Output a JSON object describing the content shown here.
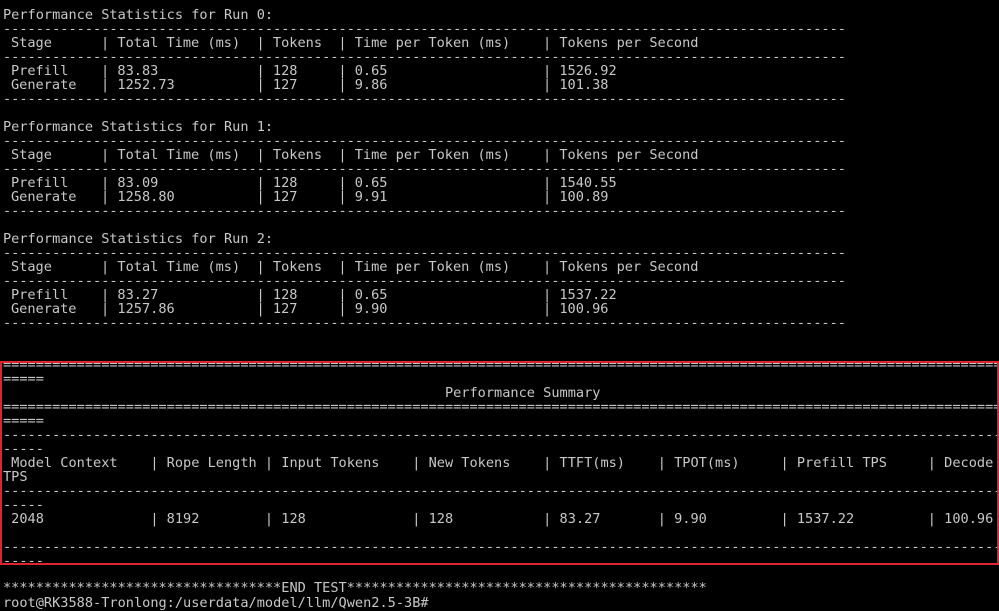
{
  "terminal": {
    "run0": {
      "title": "Performance Statistics for Run 0:",
      "separator": "-------------------------------------------------------------------------------------------------------",
      "header": "Stage      | Total Time (ms)  | Tokens  | Time per Token (ms)    | Tokens per Second",
      "row_prefill": "Prefill    | 83.83            | 128     | 0.65                   | 1526.92",
      "row_generate": "Generate   | 1252.73          | 127     | 9.86                   | 101.38"
    },
    "run1": {
      "title": "Performance Statistics for Run 1:",
      "separator": "-------------------------------------------------------------------------------------------------------",
      "header": "Stage      | Total Time (ms)  | Tokens  | Time per Token (ms)    | Tokens per Second",
      "row_prefill": "Prefill    | 83.09            | 128     | 0.65                   | 1540.55",
      "row_generate": "Generate   | 1258.80          | 127     | 9.91                   | 100.89"
    },
    "run2": {
      "title": "Performance Statistics for Run 2:",
      "separator": "-------------------------------------------------------------------------------------------------------",
      "header": "Stage      | Total Time (ms)  | Tokens  | Time per Token (ms)    | Tokens per Second",
      "row_prefill": "Prefill    | 83.27            | 128     | 0.65                   | 1537.22",
      "row_generate": "Generate   | 1257.86          | 127     | 9.90                   | 100.96"
    },
    "summary": {
      "equals_line": "=============================================================================================================================",
      "equals_wrap": "=====",
      "title": "                                                      Performance Summary",
      "dash_line": "-----------------------------------------------------------------------------------------------------------------------------",
      "dash_wrap": "-----",
      "header": " Model Context    | Rope Length | Input Tokens    | New Tokens    | TTFT(ms)    | TPOT(ms)     | Prefill TPS     | Decode",
      "header_wrap": "TPS",
      "row": " 2048             | 8192        | 128             | 128           | 83.27       | 9.90         | 1537.22         | 100.96"
    },
    "end_test": "**********************************END TEST********************************************",
    "prompt": "root@RK3588-Tronlong:/userdata/model/llm/Qwen2.5-3B#"
  }
}
